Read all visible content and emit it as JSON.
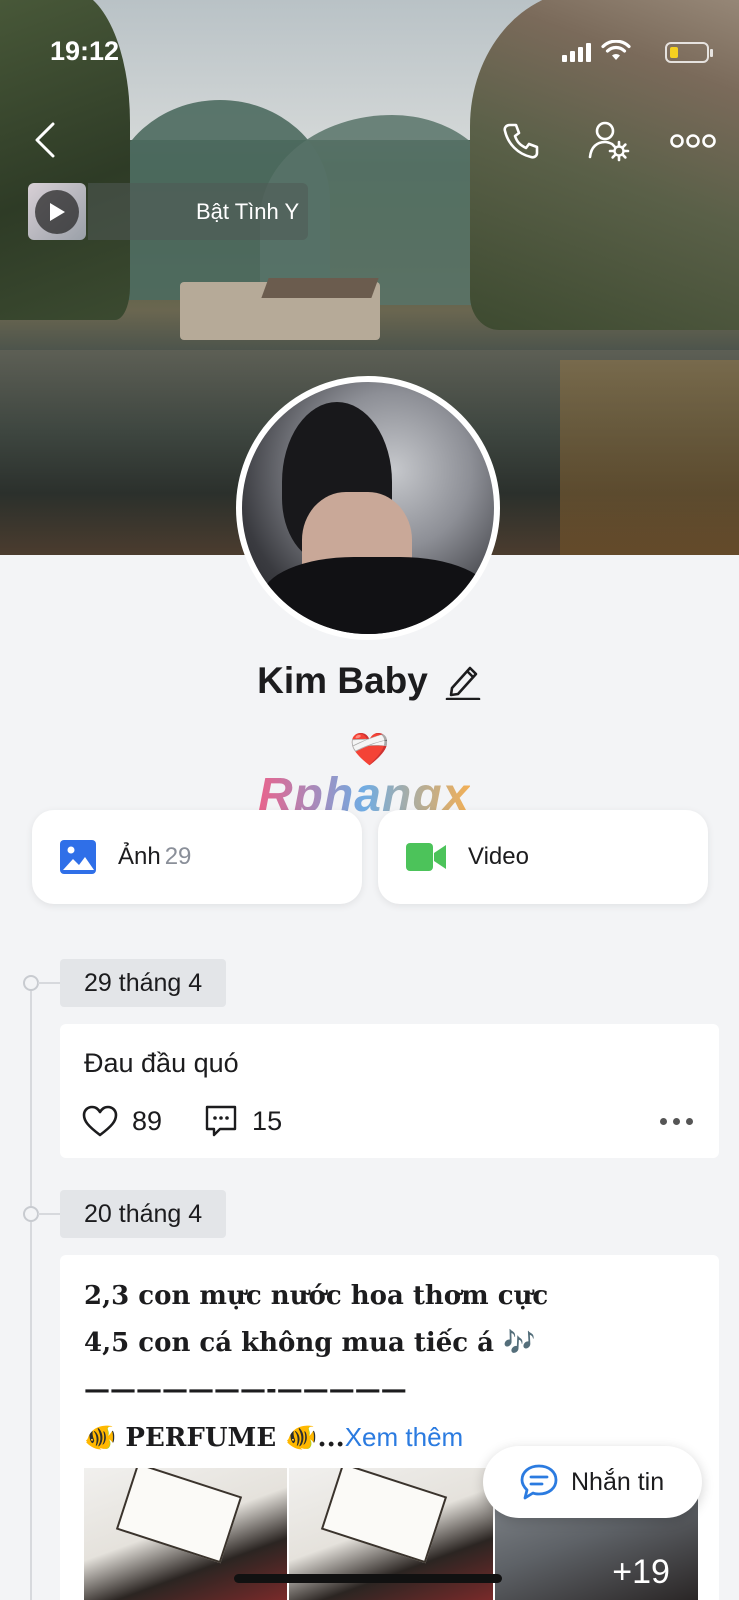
{
  "status_bar": {
    "time": "19:12"
  },
  "music": {
    "label": "Bật Tình Y"
  },
  "profile": {
    "name": "Kim Baby",
    "bio": "❤️‍🩹"
  },
  "watermark": "Rphangx",
  "media": {
    "photos_label": "Ảnh",
    "photos_count": "29",
    "video_label": "Video"
  },
  "posts": [
    {
      "date": "29 tháng 4",
      "text": "Đau đầu quó",
      "likes": "89",
      "comments": "15"
    },
    {
      "date": "20 tháng 4",
      "lines": [
        "2,3 con mực nước hoa thơm cực",
        "4,5 con cá không mua tiếc á 🎶",
        "———————-—————"
      ],
      "last_line": " 🐠 PERFUME 🐠...",
      "see_more": "Xem thêm",
      "extra_photos": "+19"
    }
  ],
  "fab": {
    "label": "Nhắn tin"
  },
  "colors": {
    "accent": "#2b7be0",
    "video_green": "#4cc35a",
    "photo_blue": "#2f6fe8"
  },
  "icons": [
    "back-icon",
    "phone-icon",
    "user-settings-icon",
    "more-icon",
    "play-icon",
    "edit-icon",
    "photo-icon",
    "video-icon",
    "heart-icon",
    "comment-icon",
    "chat-icon"
  ]
}
